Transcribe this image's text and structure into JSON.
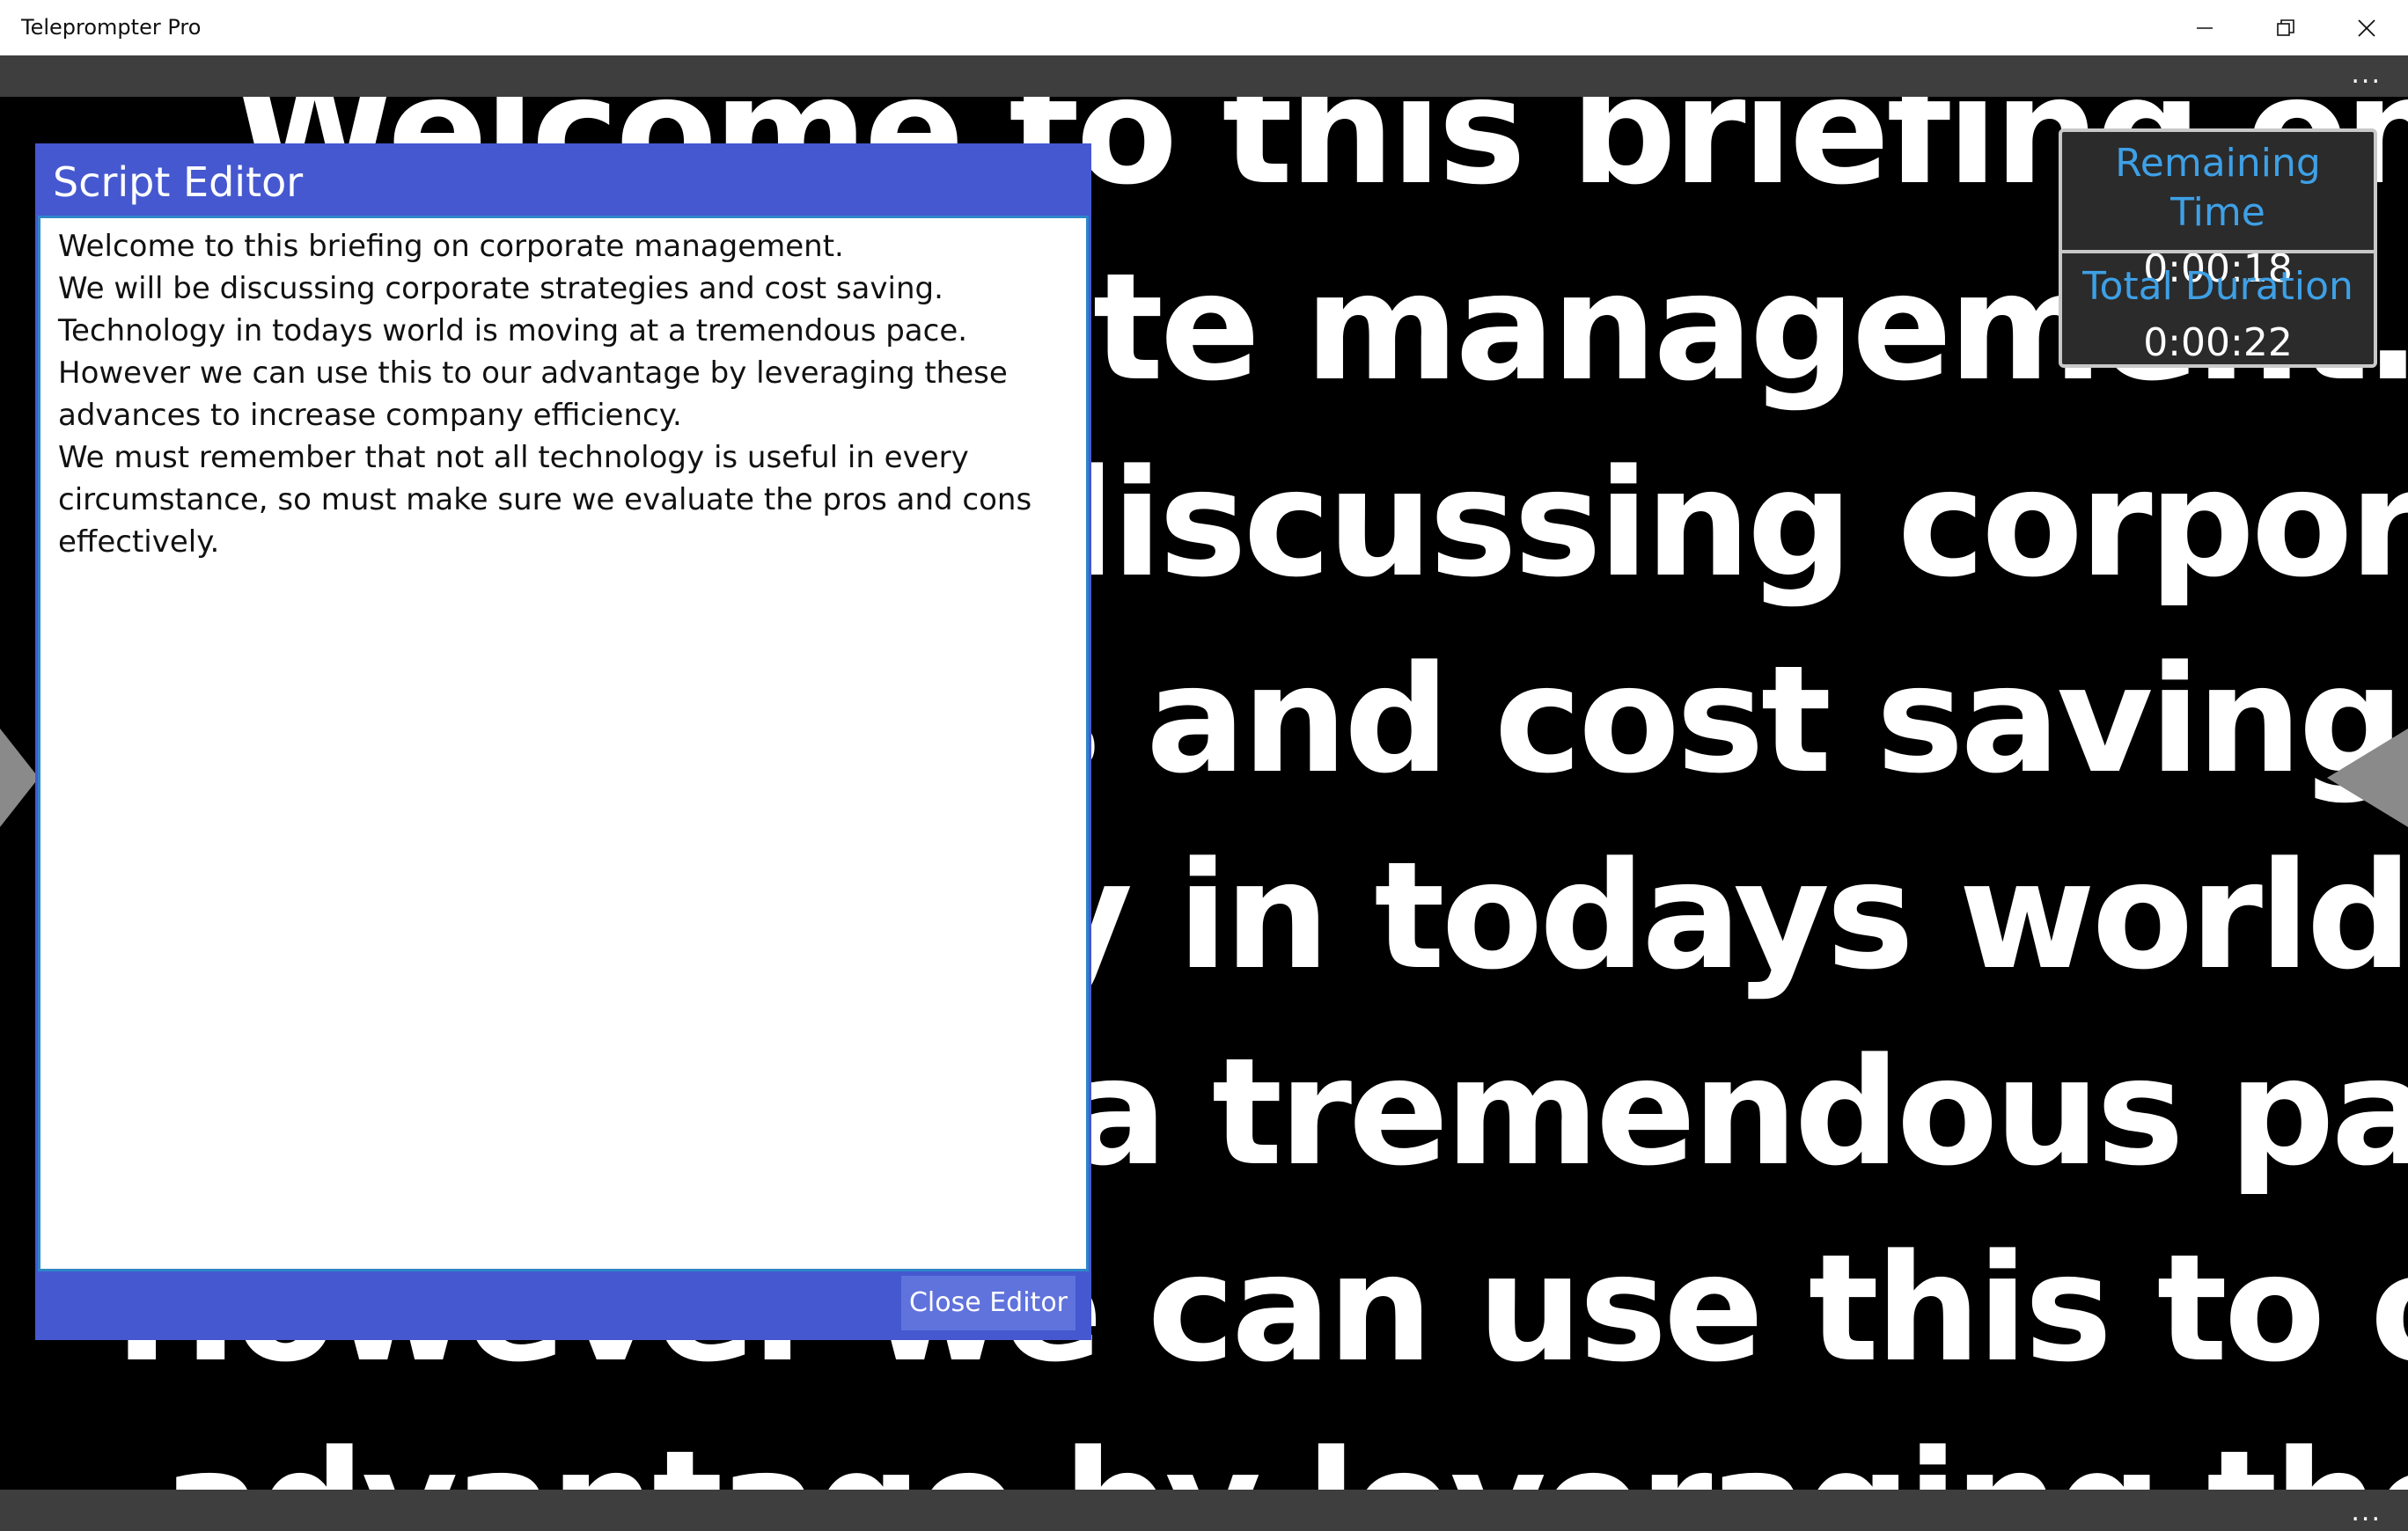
{
  "window": {
    "title": "Teleprompter Pro",
    "controls": [
      "minimize-icon",
      "restore-icon",
      "close-icon"
    ]
  },
  "command_bar": {
    "more_label": "..."
  },
  "bottom_bar": {
    "more_label": "..."
  },
  "prompter": {
    "lines": [
      "Welcome to this briefing on",
      "corporate management.",
      "We will be discussing corporate",
      "strategies and cost saving.",
      "Technology in todays world is",
      "moving at a tremendous pace.",
      "However we can use this to our",
      "advantage by leveraging these"
    ]
  },
  "timer": {
    "remaining_label": "Remaining Time",
    "remaining_value": "0:00:18",
    "total_label": "Total Duration",
    "total_value": "0:00:22"
  },
  "editor": {
    "title": "Script Editor",
    "text": "Welcome to this briefing on corporate management.\nWe will be discussing corporate strategies and cost saving.\nTechnology in todays world is moving at a tremendous pace.\nHowever we can use this to our advantage by leveraging these advances to increase company efficiency.\nWe must remember that not all technology is useful in every circumstance, so must make sure we evaluate the pros and cons effectively.",
    "close_label": "Close Editor"
  },
  "colors": {
    "editor_accent": "#4558d0",
    "timer_label": "#3ea0e6",
    "background": "#000000"
  }
}
